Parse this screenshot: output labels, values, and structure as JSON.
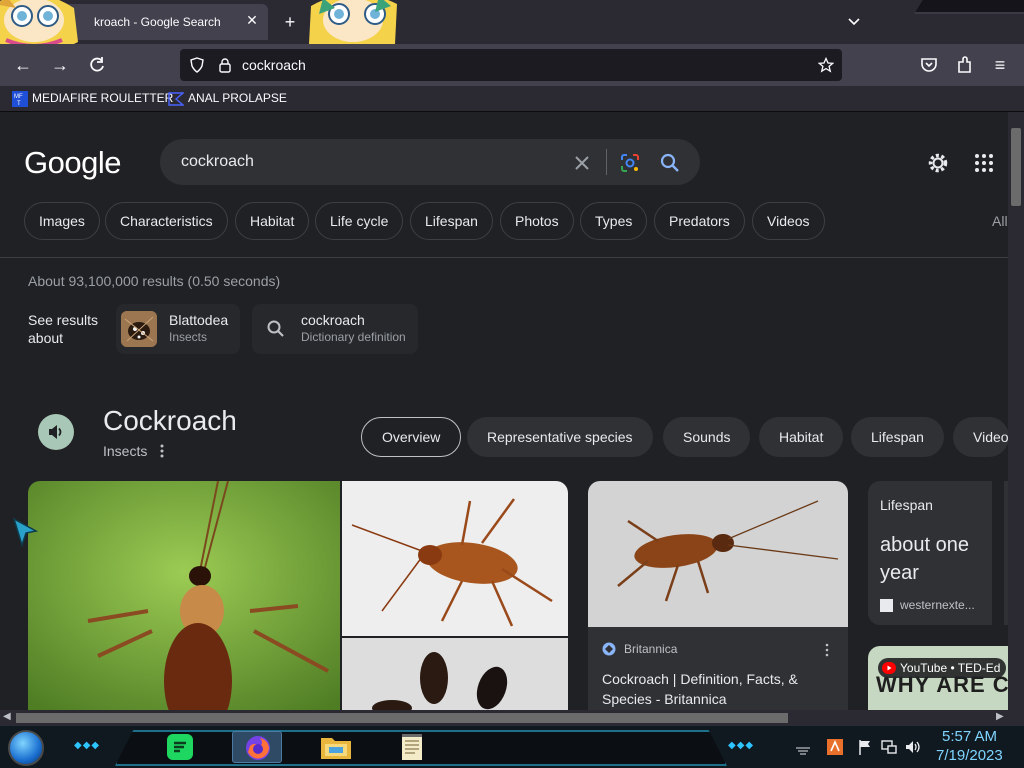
{
  "browser": {
    "tab_title": "kroach - Google Search",
    "tab_close": "✕",
    "new_tab": "+",
    "url": "cockroach",
    "bookmarks": [
      {
        "label": "MEDIAFIRE ROULETTER",
        "icon": "mediafire-icon"
      },
      {
        "label": "ANAL PROLAPSE",
        "icon": "bookmark-folder-icon"
      }
    ]
  },
  "google": {
    "logo": "Google",
    "query": "cockroach",
    "chips": [
      "Images",
      "Characteristics",
      "Habitat",
      "Life cycle",
      "Lifespan",
      "Photos",
      "Types",
      "Predators",
      "Videos"
    ],
    "chip_all": "All",
    "stats": "About 93,100,000 results (0.50 seconds)",
    "see_results_about": "See results about",
    "entities": [
      {
        "title": "Blattodea",
        "subtitle": "Insects"
      },
      {
        "title": "cockroach",
        "subtitle": "Dictionary definition"
      }
    ]
  },
  "knowledge_panel": {
    "title": "Cockroach",
    "subtitle": "Insects",
    "tabs": [
      {
        "label": "Overview",
        "active": true
      },
      {
        "label": "Representative species",
        "active": false
      },
      {
        "label": "Sounds",
        "active": false
      },
      {
        "label": "Habitat",
        "active": false
      },
      {
        "label": "Lifespan",
        "active": false
      },
      {
        "label": "Video",
        "active": false
      }
    ],
    "source_card": {
      "source": "Britannica",
      "title": "Cockroach | Definition, Facts, & Species - Britannica"
    },
    "lifespan_card": {
      "label": "Lifespan",
      "value": "about one year",
      "source": "westernexte..."
    },
    "video_card": {
      "badge": "YouTube • TED-Ed",
      "thumb_text": "WHY ARE COCKROACHES"
    }
  },
  "taskbar": {
    "time": "5:57 AM",
    "date": "7/19/2023"
  },
  "colors": {
    "page_bg": "#202124",
    "chrome_bg": "#2b2a33",
    "urlbar_bg": "#1c1b22",
    "taskbar_accent": "#2ec4ff",
    "clock": "#7fd4ff"
  }
}
